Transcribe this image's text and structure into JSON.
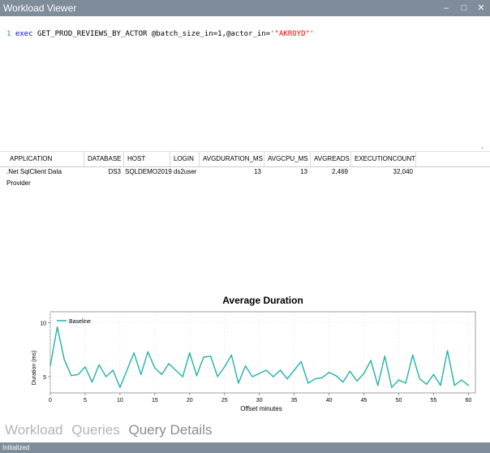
{
  "window": {
    "title": "Workload Viewer",
    "minimize": "–",
    "maximize": "□",
    "close": "✕"
  },
  "editor": {
    "line_number": "1",
    "keyword": "exec",
    "text": " GET_PROD_REVIEWS_BY_ACTOR @batch_size_in=1,@actor_in=",
    "string": "'\"AKROYD\"'"
  },
  "grid": {
    "columns": [
      "APPLICATION",
      "DATABASE",
      "HOST",
      "LOGIN",
      "AVGDURATION_MS",
      "AVGCPU_MS",
      "AVGREADS",
      "EXECUTIONCOUNT"
    ],
    "rows": [
      [
        ".Net SqlClient Data Provider",
        "DS3",
        "SQLDEMO2019",
        "ds2user",
        "13",
        "13",
        "2,469",
        "32,040"
      ]
    ]
  },
  "chart_data": {
    "type": "line",
    "title": "Average Duration",
    "xlabel": "Offset minutes",
    "ylabel": "Duration (ms)",
    "xlim": [
      0,
      61
    ],
    "ylim": [
      3.5,
      11
    ],
    "xticks": [
      "0",
      "5",
      "10",
      "15",
      "20",
      "25",
      "30",
      "35",
      "40",
      "45",
      "50",
      "55",
      "60"
    ],
    "yticks": [
      "5",
      "10"
    ],
    "legend": "top-left",
    "grid": true,
    "color": "#20b2aa",
    "series": [
      {
        "name": "Baseline",
        "x": [
          0,
          1,
          2,
          3,
          4,
          5,
          6,
          7,
          8,
          9,
          10,
          11,
          12,
          13,
          14,
          15,
          16,
          17,
          18,
          19,
          20,
          21,
          22,
          23,
          24,
          25,
          26,
          27,
          28,
          29,
          30,
          31,
          32,
          33,
          34,
          35,
          36,
          37,
          38,
          39,
          40,
          41,
          42,
          43,
          44,
          45,
          46,
          47,
          48,
          49,
          50,
          51,
          52,
          53,
          54,
          55,
          56,
          57,
          58,
          59,
          60
        ],
        "values": [
          6,
          9.6,
          6.6,
          5.1,
          5.2,
          5.9,
          4.5,
          6.1,
          5.0,
          5.6,
          4.0,
          5.6,
          7.2,
          5.2,
          7.3,
          5.8,
          5.2,
          6.2,
          5.6,
          5.0,
          7.2,
          5.1,
          6.8,
          6.9,
          5.0,
          5.9,
          7.0,
          4.4,
          6.0,
          5.0,
          5.3,
          5.6,
          5.0,
          5.6,
          4.8,
          5.6,
          6.4,
          4.4,
          4.8,
          4.9,
          5.4,
          5.1,
          4.5,
          5.5,
          4.6,
          5.3,
          6.5,
          4.2,
          6.9,
          4.0,
          4.7,
          4.4,
          7.0,
          4.8,
          4.3,
          5.2,
          4.2,
          7.4,
          4.2,
          4.7,
          4.2
        ]
      }
    ]
  },
  "tabs": [
    "Workload",
    "Queries",
    "Query Details"
  ],
  "status": "Initialized"
}
